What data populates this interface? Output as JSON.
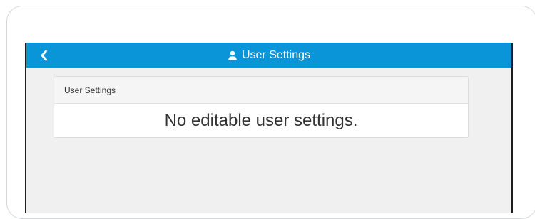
{
  "header": {
    "title": "User Settings",
    "back_icon": "chevron-left-icon",
    "title_icon": "user-icon",
    "bar_color": "#0a95d8"
  },
  "panel": {
    "heading": "User Settings",
    "message": "No editable user settings."
  }
}
